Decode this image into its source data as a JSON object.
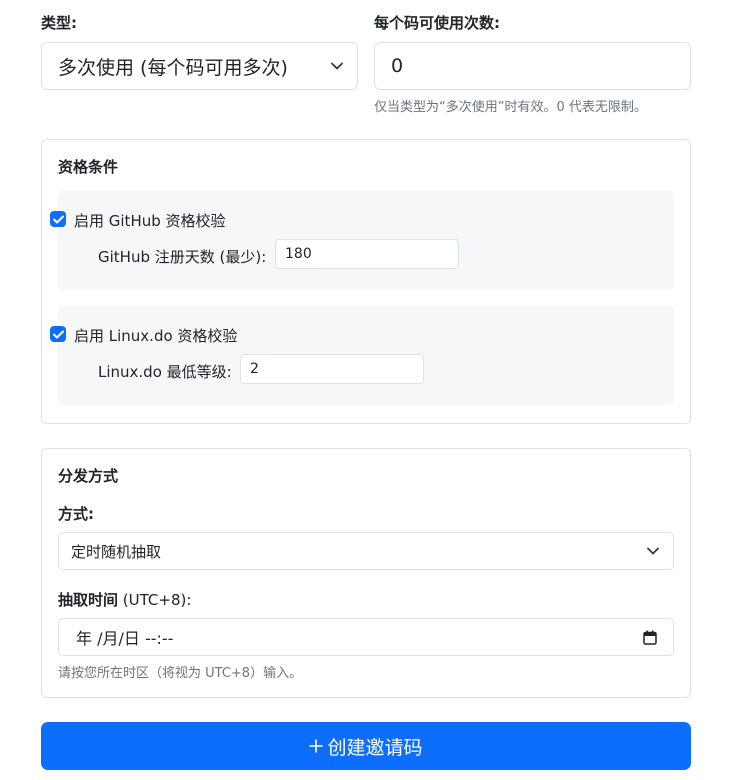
{
  "type_field": {
    "label": "类型:",
    "selected": "多次使用 (每个码可用多次)"
  },
  "uses_field": {
    "label": "每个码可使用次数:",
    "value": "0",
    "help": "仅当类型为“多次使用”时有效。0 代表无限制。"
  },
  "eligibility": {
    "title": "资格条件",
    "github": {
      "checkbox_label": "启用 GitHub 资格校验",
      "checked": true,
      "field_label": "GitHub 注册天数 (最少):",
      "value": "180"
    },
    "linuxdo": {
      "checkbox_label": "启用 Linux.do 资格校验",
      "checked": true,
      "field_label": "Linux.do 最低等级:",
      "value": "2"
    }
  },
  "distribution": {
    "title": "分发方式",
    "method_label": "方式:",
    "method_selected": "定时随机抽取",
    "time_label": "抽取时间 (UTC+8):",
    "time_value": "年 /月/日 --:--",
    "help": "请按您所在时区（将视为 UTC+8）输入。"
  },
  "submit": {
    "icon": "plus-icon",
    "label": "创建邀请码"
  },
  "colors": {
    "primary": "#0d6efd",
    "border": "#dee2e6",
    "muted": "#6c757d",
    "subcard_bg": "#f6f7f8"
  }
}
